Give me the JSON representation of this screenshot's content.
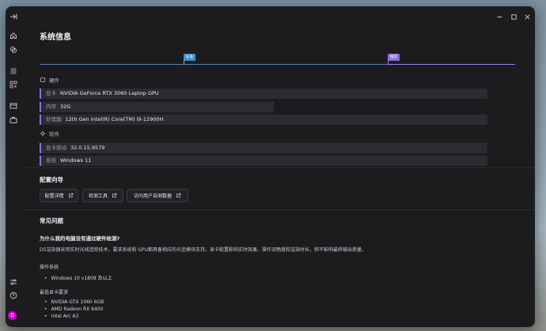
{
  "window": {
    "title": "系统信息",
    "controls": [
      "minimize-icon",
      "maximize-icon",
      "close-icon"
    ]
  },
  "sidebar": {
    "icons": [
      "collapse-icon",
      "home-icon",
      "layers-icon",
      "grid-icon",
      "qr-icon",
      "window-icon",
      "briefcase-icon",
      "sliders-icon",
      "help-icon"
    ],
    "avatar_letter": "D"
  },
  "progress": {
    "marker_low": "标准",
    "marker_high": "推荐",
    "colors": {
      "standard": "#4a90d9",
      "recommended": "#8d6ee0"
    }
  },
  "hardware": {
    "title": "硬件",
    "rows": [
      {
        "key": "显卡",
        "value": "NVIDIA GeForce RTX 3060 Laptop GPU"
      },
      {
        "key": "内存",
        "value": "32G"
      },
      {
        "key": "处理器",
        "value": "12th Gen Intel(R) Core(TM) i9-12900H"
      }
    ]
  },
  "software": {
    "title": "软件",
    "rows": [
      {
        "key": "显卡驱动",
        "value": "32.0.15.9579"
      },
      {
        "key": "系统",
        "value": "Windows 11"
      }
    ]
  },
  "config_guide": {
    "title": "配置向导",
    "buttons": [
      "配置详情",
      "检测工具",
      "访问用户自测数据"
    ]
  },
  "faq": {
    "title": "常见问题",
    "question": "为什么我的电脑没有通过硬件检测?",
    "answer": "D5渲染器采用实时光线追踪技术，要求系统和 GPU都具备相应的光追模块支持。显卡配置影响实时效果、操作流畅度和渲染时长，但不影响最终输出质量。",
    "os_label": "操作系统",
    "os_items": [
      "Windows 10 v1809 及以上"
    ],
    "gpu_label": "最低显卡要求",
    "gpu_items": [
      "NVIDIA GTX 1060 6GB",
      "AMD Radeon RX 6400",
      "Intel Arc A3"
    ]
  }
}
